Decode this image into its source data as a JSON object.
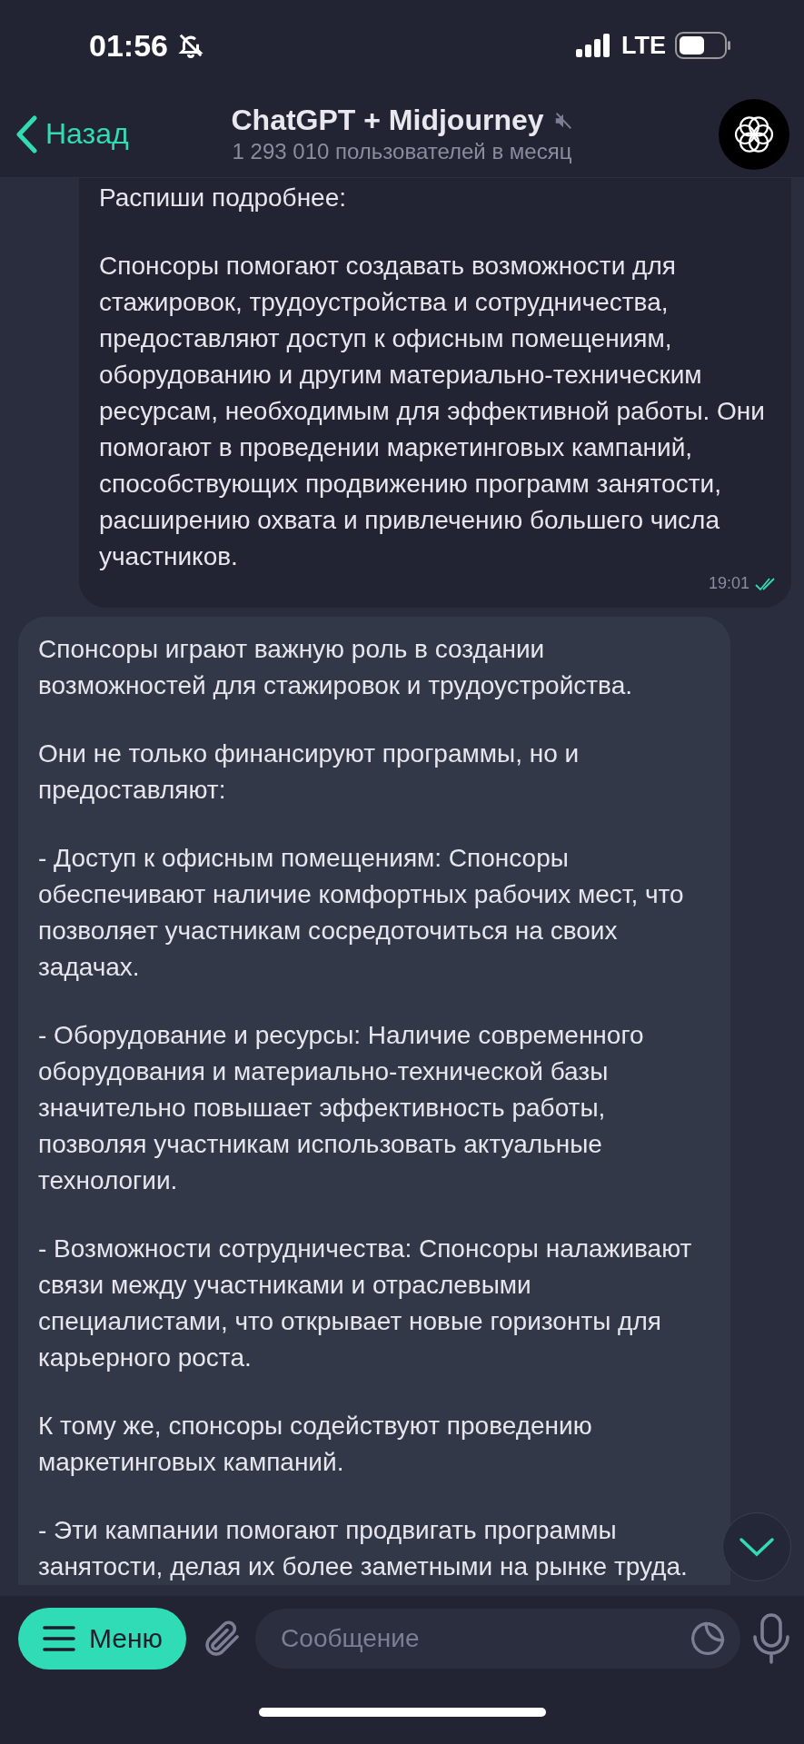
{
  "status_bar": {
    "time": "01:56",
    "network": "LTE",
    "silent": true
  },
  "header": {
    "back_label": "Назад",
    "title": "ChatGPT + Midjourney",
    "muted": true,
    "subtitle": "1 293 010 пользователей в месяц"
  },
  "messages": [
    {
      "outgoing": true,
      "paragraphs": [
        "Распиши подробнее:",
        "Спонсоры помогают создавать возможности для стажировок, трудоустройства и сотрудничества, предоставляют доступ к офисным помещениям, оборудованию и другим материально-техническим ресурсам, необходимым для эффективной работы. Они помогают в проведении маркетинговых кампаний, способствующих продвижению программ занятости, расширению охвата и привлечению большего числа участников."
      ],
      "time": "19:01",
      "read": true
    },
    {
      "outgoing": false,
      "paragraphs": [
        "Спонсоры играют важную роль в создании возможностей для стажировок и трудоустройства.",
        "Они не только финансируют программы, но и предоставляют:",
        "- Доступ к офисным помещениям: Спонсоры обеспечивают наличие комфортных рабочих мест, что позволяет участникам сосредоточиться на своих задачах.",
        "- Оборудование и ресурсы: Наличие современного оборудования и материально-технической базы значительно повышает эффективность работы, позволяя участникам использовать актуальные технологии.",
        "- Возможности сотрудничества: Спонсоры налаживают связи между участниками и отраслевыми специалистами, что открывает новые горизонты для карьерного роста.",
        "К тому же, спонсоры содействуют проведению маркетинговых кампаний.",
        "- Эти кампании помогают продвигать программы занятости, делая их более заметными на рынке труда."
      ]
    }
  ],
  "composer": {
    "menu_label": "Меню",
    "placeholder": "Сообщение"
  }
}
